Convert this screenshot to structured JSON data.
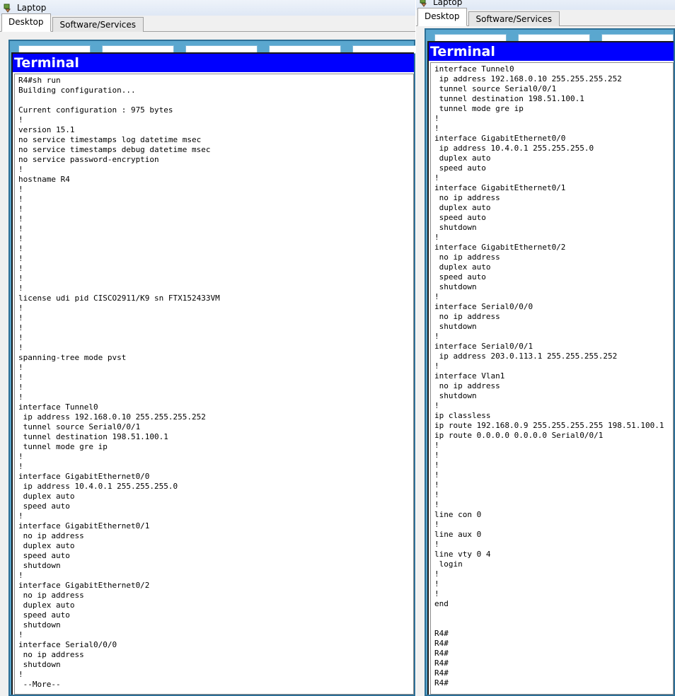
{
  "left_window": {
    "title": "Laptop",
    "tabs": [
      "Desktop",
      "Software/Services"
    ],
    "terminal_title": "Terminal",
    "terminal_lines": [
      "R4#sh run",
      "Building configuration...",
      "",
      "Current configuration : 975 bytes",
      "!",
      "version 15.1",
      "no service timestamps log datetime msec",
      "no service timestamps debug datetime msec",
      "no service password-encryption",
      "!",
      "hostname R4",
      "!",
      "!",
      "!",
      "!",
      "!",
      "!",
      "!",
      "!",
      "!",
      "!",
      "!",
      "license udi pid CISCO2911/K9 sn FTX152433VM",
      "!",
      "!",
      "!",
      "!",
      "!",
      "spanning-tree mode pvst",
      "!",
      "!",
      "!",
      "!",
      "interface Tunnel0",
      " ip address 192.168.0.10 255.255.255.252",
      " tunnel source Serial0/0/1",
      " tunnel destination 198.51.100.1",
      " tunnel mode gre ip",
      "!",
      "!",
      "interface GigabitEthernet0/0",
      " ip address 10.4.0.1 255.255.255.0",
      " duplex auto",
      " speed auto",
      "!",
      "interface GigabitEthernet0/1",
      " no ip address",
      " duplex auto",
      " speed auto",
      " shutdown",
      "!",
      "interface GigabitEthernet0/2",
      " no ip address",
      " duplex auto",
      " speed auto",
      " shutdown",
      "!",
      "interface Serial0/0/0",
      " no ip address",
      " shutdown",
      "!",
      " --More--"
    ]
  },
  "right_window": {
    "title": "Laptop",
    "tabs": [
      "Desktop",
      "Software/Services"
    ],
    "terminal_title": "Terminal",
    "terminal_lines": [
      "interface Tunnel0",
      " ip address 192.168.0.10 255.255.255.252",
      " tunnel source Serial0/0/1",
      " tunnel destination 198.51.100.1",
      " tunnel mode gre ip",
      "!",
      "!",
      "interface GigabitEthernet0/0",
      " ip address 10.4.0.1 255.255.255.0",
      " duplex auto",
      " speed auto",
      "!",
      "interface GigabitEthernet0/1",
      " no ip address",
      " duplex auto",
      " speed auto",
      " shutdown",
      "!",
      "interface GigabitEthernet0/2",
      " no ip address",
      " duplex auto",
      " speed auto",
      " shutdown",
      "!",
      "interface Serial0/0/0",
      " no ip address",
      " shutdown",
      "!",
      "interface Serial0/0/1",
      " ip address 203.0.113.1 255.255.255.252",
      "!",
      "interface Vlan1",
      " no ip address",
      " shutdown",
      "!",
      "ip classless",
      "ip route 192.168.0.9 255.255.255.255 198.51.100.1",
      "ip route 0.0.0.0 0.0.0.0 Serial0/0/1",
      "!",
      "!",
      "!",
      "!",
      "!",
      "!",
      "!",
      "line con 0",
      "!",
      "line aux 0",
      "!",
      "line vty 0 4",
      " login",
      "!",
      "!",
      "!",
      "end",
      "",
      "",
      "R4#",
      "R4#",
      "R4#",
      "R4#",
      "R4#",
      "R4#"
    ]
  }
}
